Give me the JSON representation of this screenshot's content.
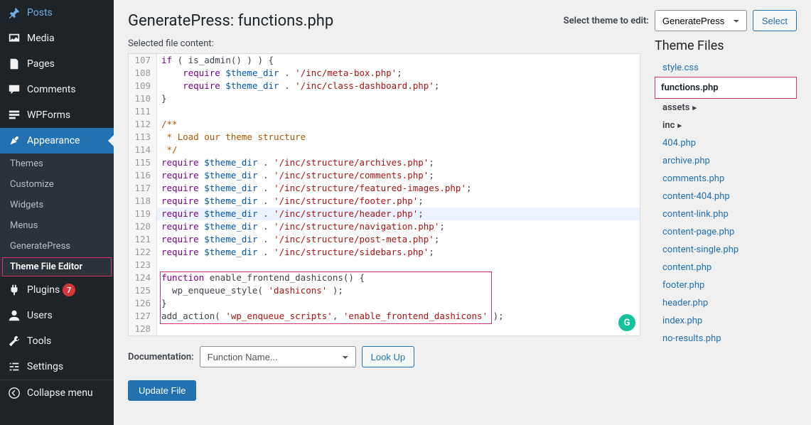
{
  "sidebar": {
    "items": [
      {
        "label": "Posts",
        "icon": "pin"
      },
      {
        "label": "Media",
        "icon": "media"
      },
      {
        "label": "Pages",
        "icon": "page"
      },
      {
        "label": "Comments",
        "icon": "comment"
      },
      {
        "label": "WPForms",
        "icon": "form"
      }
    ],
    "appearance": {
      "label": "Appearance",
      "icon": "brush"
    },
    "submenu": [
      {
        "label": "Themes"
      },
      {
        "label": "Customize"
      },
      {
        "label": "Widgets"
      },
      {
        "label": "Menus"
      },
      {
        "label": "GeneratePress"
      },
      {
        "label": "Theme File Editor"
      }
    ],
    "after": [
      {
        "label": "Plugins",
        "icon": "plugin",
        "badge": "7"
      },
      {
        "label": "Users",
        "icon": "user"
      },
      {
        "label": "Tools",
        "icon": "wrench"
      },
      {
        "label": "Settings",
        "icon": "settings"
      }
    ],
    "collapse": {
      "label": "Collapse menu",
      "icon": "collapse"
    }
  },
  "header": {
    "title": "GeneratePress: functions.php",
    "select_label": "Select theme to edit:",
    "theme": "GeneratePress",
    "select_btn": "Select"
  },
  "editor": {
    "selected_label": "Selected file content:",
    "lines": [
      {
        "n": 107,
        "html": "<span class='kw'>if</span> ( is_admin() ) ) {"
      },
      {
        "n": 108,
        "html": "    <span class='kw'>require</span> <span class='var'>$theme_dir</span> . <span class='str'>'/inc/meta-box.php'</span>;"
      },
      {
        "n": 109,
        "html": "    <span class='kw'>require</span> <span class='var'>$theme_dir</span> . <span class='str'>'/inc/class-dashboard.php'</span>;"
      },
      {
        "n": 110,
        "html": "}"
      },
      {
        "n": 111,
        "html": ""
      },
      {
        "n": 112,
        "html": "<span class='com'>/**</span>"
      },
      {
        "n": 113,
        "html": "<span class='com'> * Load our theme structure</span>"
      },
      {
        "n": 114,
        "html": "<span class='com'> */</span>"
      },
      {
        "n": 115,
        "html": "<span class='kw'>require</span> <span class='var'>$theme_dir</span> . <span class='str'>'/inc/structure/archives.php'</span>;"
      },
      {
        "n": 116,
        "html": "<span class='kw'>require</span> <span class='var'>$theme_dir</span> . <span class='str'>'/inc/structure/comments.php'</span>;"
      },
      {
        "n": 117,
        "html": "<span class='kw'>require</span> <span class='var'>$theme_dir</span> . <span class='str'>'/inc/structure/featured-images.php'</span>;"
      },
      {
        "n": 118,
        "html": "<span class='kw'>require</span> <span class='var'>$theme_dir</span> . <span class='str'>'/inc/structure/footer.php'</span>;"
      },
      {
        "n": 119,
        "html": "<span class='kw'>require</span> <span class='var'>$theme_dir</span> . <span class='str'>'/inc/structure/header.php'</span>;",
        "hl": true
      },
      {
        "n": 120,
        "html": "<span class='kw'>require</span> <span class='var'>$theme_dir</span> . <span class='str'>'/inc/structure/navigation.php'</span>;"
      },
      {
        "n": 121,
        "html": "<span class='kw'>require</span> <span class='var'>$theme_dir</span> . <span class='str'>'/inc/structure/post-meta.php'</span>;"
      },
      {
        "n": 122,
        "html": "<span class='kw'>require</span> <span class='var'>$theme_dir</span> . <span class='str'>'/inc/structure/sidebars.php'</span>;"
      },
      {
        "n": 123,
        "html": ""
      },
      {
        "n": 124,
        "html": "<span class='kw'>function</span> enable_frontend_dashicons() {"
      },
      {
        "n": 125,
        "html": "  wp_enqueue_style( <span class='str'>'dashicons'</span> );"
      },
      {
        "n": 126,
        "html": "}"
      },
      {
        "n": 127,
        "html": "add_action( <span class='str'>'wp_enqueue_scripts'</span>, <span class='str'>'enable_frontend_dashicons'</span> );"
      },
      {
        "n": 128,
        "html": ""
      }
    ]
  },
  "files": {
    "title": "Theme Files",
    "items": [
      {
        "label": "style.css"
      },
      {
        "label": "functions.php",
        "active": true
      },
      {
        "label": "assets",
        "folder": true
      },
      {
        "label": "inc",
        "folder": true
      },
      {
        "label": "404.php"
      },
      {
        "label": "archive.php"
      },
      {
        "label": "comments.php"
      },
      {
        "label": "content-404.php"
      },
      {
        "label": "content-link.php"
      },
      {
        "label": "content-page.php"
      },
      {
        "label": "content-single.php"
      },
      {
        "label": "content.php"
      },
      {
        "label": "footer.php"
      },
      {
        "label": "header.php"
      },
      {
        "label": "index.php"
      },
      {
        "label": "no-results.php"
      }
    ]
  },
  "doc": {
    "label": "Documentation:",
    "placeholder": "Function Name...",
    "lookup": "Look Up"
  },
  "update": {
    "label": "Update File"
  }
}
